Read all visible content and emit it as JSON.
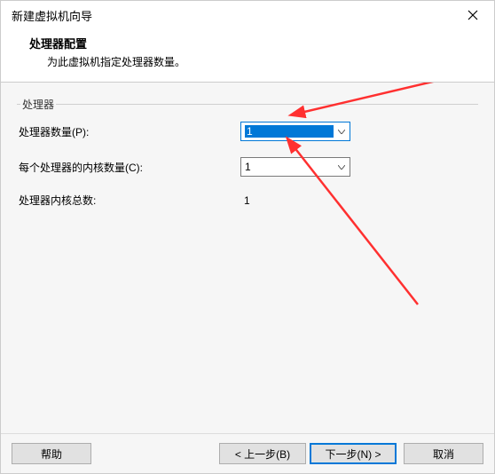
{
  "titlebar": {
    "title": "新建虚拟机向导"
  },
  "header": {
    "title": "处理器配置",
    "subtitle": "为此虚拟机指定处理器数量。"
  },
  "group": {
    "legend": "处理器"
  },
  "labels": {
    "processors": "处理器数量(P):",
    "cores_per": "每个处理器的内核数量(C):",
    "total_cores": "处理器内核总数:"
  },
  "values": {
    "processors": "1",
    "cores_per": "1",
    "total_cores": "1"
  },
  "buttons": {
    "help": "帮助",
    "back": "< 上一步(B)",
    "next": "下一步(N) >",
    "cancel": "取消"
  },
  "colors": {
    "arrow": "#ff3030",
    "highlight": "#0078d7"
  }
}
